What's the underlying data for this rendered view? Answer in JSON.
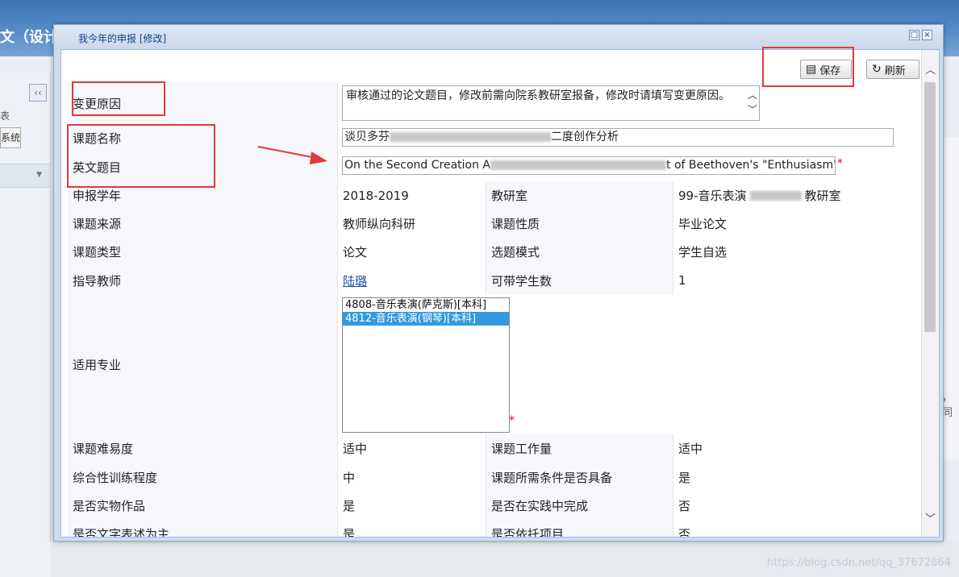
{
  "background": {
    "title_fragment": "文（设计",
    "collapse_glyph": "‹‹",
    "side_text": "表",
    "side_button": "系统",
    "right_fragment": "，同",
    "watermark": "https://blog.csdn.net/qq_37672864"
  },
  "dialog": {
    "title": "我今年的申报 [修改]",
    "restore_glyph": "□",
    "close_glyph": "×"
  },
  "toolbar": {
    "save_label": "保存",
    "refresh_label": "刷新"
  },
  "form": {
    "change_reason_label": "变更原因",
    "change_reason_value": "审核通过的论文题目，修改前需向院系教研室报备，修改时请填写变更原因。",
    "topic_name_label": "课题名称",
    "topic_name_prefix": "谈贝多芬",
    "topic_name_suffix": "二度创作分析",
    "english_title_label": "英文题目",
    "english_title_prefix": "On the Second Creation A",
    "english_title_suffix": "t of Beethoven's \"Enthusiasm\" So",
    "required_mark": "*",
    "rows": [
      {
        "l1": "申报学年",
        "v1": "2018-2019",
        "l2": "教研室",
        "v2": "99-音乐表演",
        "v2b": "教研室"
      },
      {
        "l1": "课题来源",
        "v1": "教师纵向科研",
        "l2": "课题性质",
        "v2": "毕业论文"
      },
      {
        "l1": "课题类型",
        "v1": "论文",
        "l2": "选题模式",
        "v2": "学生自选"
      },
      {
        "l1": "指导教师",
        "v1": "陆璐",
        "l2": "可带学生数",
        "v2": "1"
      }
    ],
    "major_label": "适用专业",
    "major_options": [
      {
        "text": "4808-音乐表演(萨克斯)[本科]",
        "selected": false
      },
      {
        "text": "4812-音乐表演(钢琴)[本科]",
        "selected": true
      }
    ],
    "rows2": [
      {
        "l1": "课题难易度",
        "v1": "适中",
        "l2": "课题工作量",
        "v2": "适中"
      },
      {
        "l1": "综合性训练程度",
        "v1": "中",
        "l2": "课题所需条件是否具备",
        "v2": "是"
      },
      {
        "l1": "是否实物作品",
        "v1": "是",
        "l2": "是否在实践中完成",
        "v2": "否"
      },
      {
        "l1": "是否文字表述为主",
        "v1": "是",
        "l2": "是否依托项目",
        "v2": "否"
      }
    ]
  },
  "colors": {
    "annotation": "#e0393e",
    "selected_option": "#3399e0",
    "title_text": "#15428b"
  }
}
